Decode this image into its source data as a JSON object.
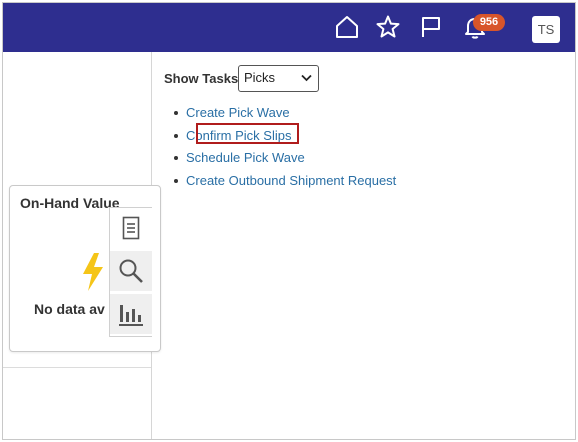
{
  "header": {
    "notification_count": "956",
    "avatar_initials": "TS",
    "icons": [
      "home-icon",
      "favorites-star-icon",
      "flag-icon",
      "notifications-bell-icon"
    ],
    "bar_color": "#2e2e8f",
    "badge_color": "#d8552a"
  },
  "left_panel": {
    "card_title": "On-Hand Value",
    "no_data_text": "No data av",
    "tools": [
      "report-icon",
      "search-icon",
      "bar-chart-icon"
    ]
  },
  "main": {
    "show_tasks_label": "Show Tasks",
    "select_value": "Picks",
    "tasks": [
      {
        "label": "Create Pick Wave"
      },
      {
        "label": "Confirm Pick Slips",
        "highlighted": true
      },
      {
        "label": "Schedule Pick Wave"
      },
      {
        "label": "Create Outbound Shipment Request"
      }
    ],
    "link_color": "#2a6fa5",
    "highlight_color": "#b01c1c"
  }
}
